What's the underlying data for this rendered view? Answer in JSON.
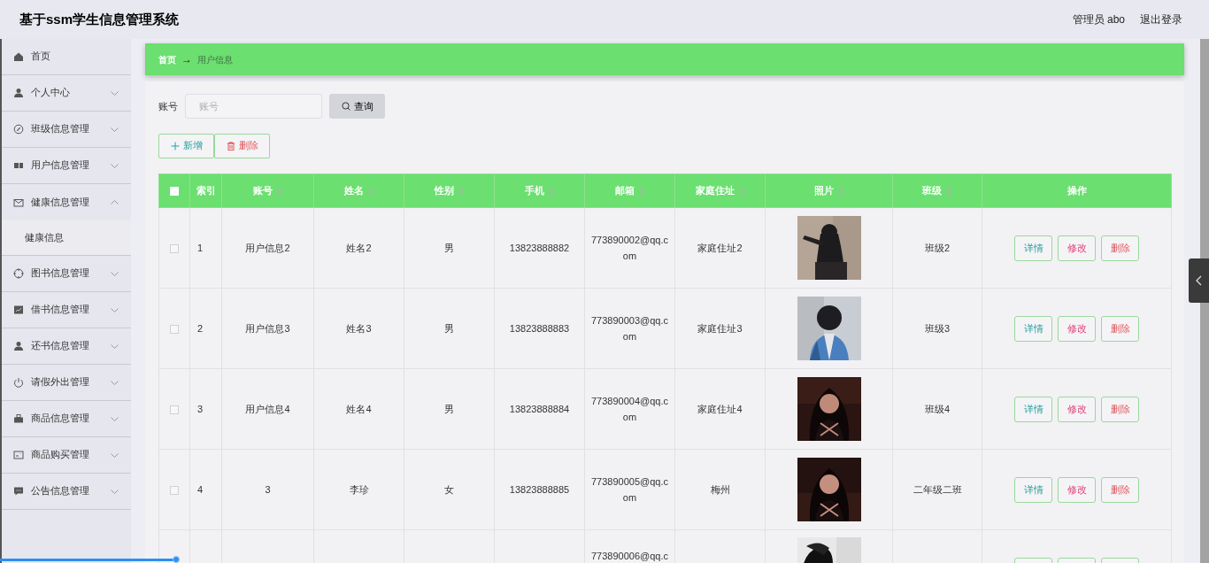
{
  "header": {
    "title": "基于ssm学生信息管理系统",
    "user": "管理员 abo",
    "logout": "退出登录"
  },
  "sidebar": {
    "items": [
      {
        "label": "首页",
        "kind": "link"
      },
      {
        "label": "个人中心",
        "kind": "menu",
        "expanded": false
      },
      {
        "label": "班级信息管理",
        "kind": "menu",
        "expanded": false
      },
      {
        "label": "用户信息管理",
        "kind": "menu",
        "expanded": false
      },
      {
        "label": "健康信息管理",
        "kind": "menu",
        "expanded": true,
        "children": [
          {
            "label": "健康信息"
          }
        ]
      },
      {
        "label": "图书信息管理",
        "kind": "menu",
        "expanded": false
      },
      {
        "label": "借书信息管理",
        "kind": "menu",
        "expanded": false
      },
      {
        "label": "还书信息管理",
        "kind": "menu",
        "expanded": false
      },
      {
        "label": "请假外出管理",
        "kind": "menu",
        "expanded": false
      },
      {
        "label": "商品信息管理",
        "kind": "menu",
        "expanded": false
      },
      {
        "label": "商品购买管理",
        "kind": "menu",
        "expanded": false
      },
      {
        "label": "公告信息管理",
        "kind": "menu",
        "expanded": false
      }
    ]
  },
  "breadcrumb": {
    "items": [
      "首页",
      "用户信息"
    ],
    "separator": "→"
  },
  "search": {
    "label": "账号",
    "placeholder": "账号",
    "button": "查询"
  },
  "toolbar": [
    {
      "label": "新增",
      "kind": "add"
    },
    {
      "label": "删除",
      "kind": "delete"
    }
  ],
  "table": {
    "select_all": {
      "checked": false
    },
    "columns": [
      {
        "label": "索引",
        "sortable": false
      },
      {
        "label": "账号",
        "sortable": true
      },
      {
        "label": "姓名",
        "sortable": true
      },
      {
        "label": "性别",
        "sortable": true
      },
      {
        "label": "手机",
        "sortable": true
      },
      {
        "label": "邮箱",
        "sortable": true
      },
      {
        "label": "家庭住址",
        "sortable": true
      },
      {
        "label": "照片",
        "sortable": true
      },
      {
        "label": "班级",
        "sortable": true
      },
      {
        "label": "操作",
        "sortable": false
      }
    ],
    "rows": [
      {
        "checked": false,
        "cells": [
          "1",
          "用户信息2",
          "姓名2",
          "男",
          "13823888882",
          "773890002@qq.com",
          "家庭住址2"
        ],
        "class": "班级2",
        "actions": [
          {
            "label": "详情",
            "kind": "detail"
          },
          {
            "label": "修改",
            "kind": "edit"
          },
          {
            "label": "删除",
            "kind": "delete"
          }
        ]
      },
      {
        "checked": false,
        "cells": [
          "2",
          "用户信息3",
          "姓名3",
          "男",
          "13823888883",
          "773890003@qq.com",
          "家庭住址3"
        ],
        "class": "班级3",
        "actions": [
          {
            "label": "详情",
            "kind": "detail"
          },
          {
            "label": "修改",
            "kind": "edit"
          },
          {
            "label": "删除",
            "kind": "delete"
          }
        ]
      },
      {
        "checked": false,
        "cells": [
          "3",
          "用户信息4",
          "姓名4",
          "男",
          "13823888884",
          "773890004@qq.com",
          "家庭住址4"
        ],
        "class": "班级4",
        "actions": [
          {
            "label": "详情",
            "kind": "detail"
          },
          {
            "label": "修改",
            "kind": "edit"
          },
          {
            "label": "删除",
            "kind": "delete"
          }
        ]
      },
      {
        "checked": false,
        "cells": [
          "4",
          "3",
          "李珍",
          "女",
          "13823888885",
          "773890005@qq.com",
          "梅州"
        ],
        "class": "二年级二班",
        "actions": [
          {
            "label": "详情",
            "kind": "detail"
          },
          {
            "label": "修改",
            "kind": "edit"
          },
          {
            "label": "删除",
            "kind": "delete"
          }
        ]
      },
      {
        "partial": true,
        "cells": [
          "",
          "",
          "",
          "",
          "",
          "773890006@qq.c",
          ""
        ],
        "actions": [
          {
            "kind": "detail"
          },
          {
            "kind": "edit"
          },
          {
            "kind": "delete"
          }
        ]
      }
    ]
  },
  "progress": {
    "level": 0.146
  }
}
